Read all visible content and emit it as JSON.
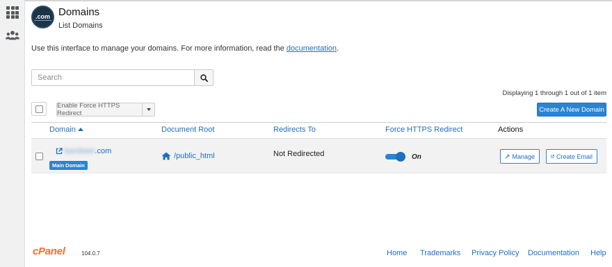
{
  "header": {
    "logo_text": ".com",
    "title": "Domains",
    "subtitle": "List Domains"
  },
  "intro": {
    "text": "Use this interface to manage your domains. For more information, read the ",
    "link": "documentation",
    "suffix": "."
  },
  "search": {
    "placeholder": "Search"
  },
  "pagination": {
    "text": "Displaying 1 through 1 out of 1 item"
  },
  "toolbar": {
    "force_https_label": "Enable Force HTTPS Redirect",
    "create_label": "Create A New Domain"
  },
  "table": {
    "columns": [
      "Domain",
      "Document Root",
      "Redirects To",
      "Force HTTPS Redirect",
      "Actions"
    ],
    "rows": [
      {
        "domain_redacted": "bambeer",
        "domain_suffix": ".com",
        "badge": "Main Domain",
        "document_root": "/public_html",
        "redirects_to": "Not Redirected",
        "force_https": "On",
        "manage_label": "Manage",
        "email_label": "Create Email"
      }
    ]
  },
  "footer": {
    "brand": "cPanel",
    "version": "104.0.7",
    "links": [
      "Home",
      "Trademarks",
      "Privacy Policy",
      "Documentation",
      "Help"
    ]
  },
  "colors": {
    "accent": "#2a84d2",
    "brand_orange": "#ff6c2c"
  }
}
